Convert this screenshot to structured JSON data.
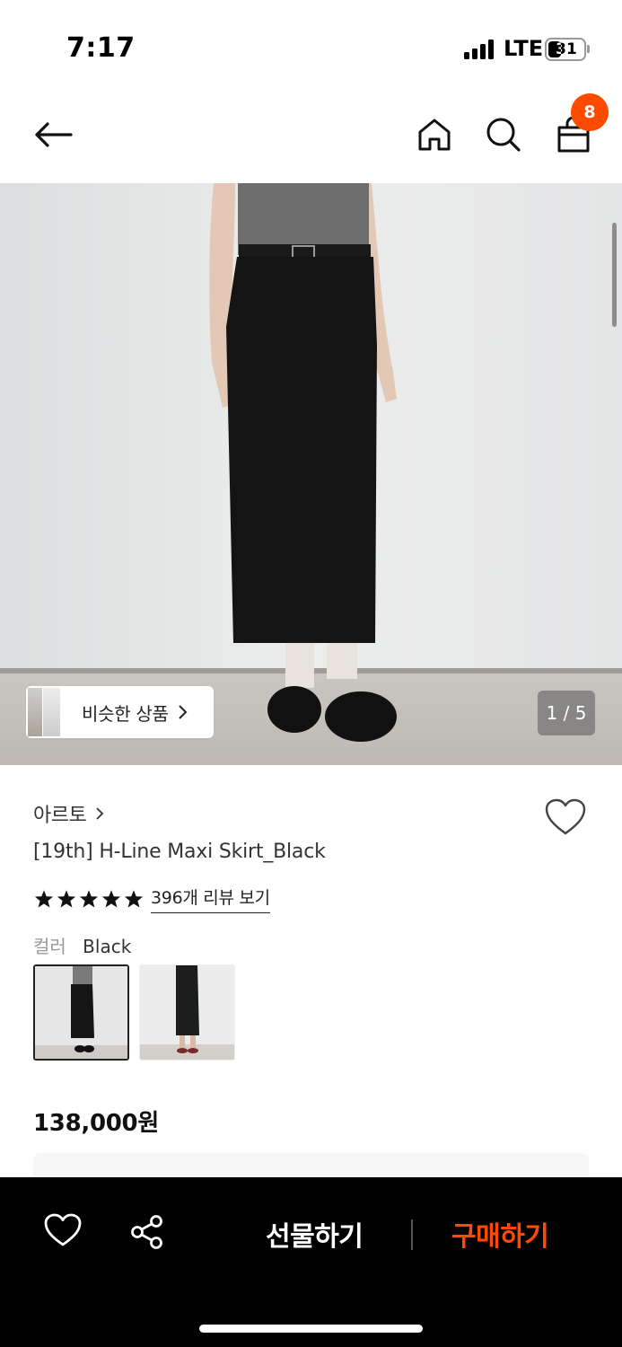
{
  "status_bar": {
    "time": "7:17",
    "network": "LTE",
    "battery": "31"
  },
  "nav": {
    "back_icon": "arrow-left-icon",
    "home_icon": "home-icon",
    "search_icon": "search-icon",
    "cart_icon": "shopping-bag-icon",
    "cart_count": "8"
  },
  "hero": {
    "similar_label": "비슷한 상품",
    "page_indicator": "1 / 5"
  },
  "product": {
    "brand": "아르토",
    "title": "[19th] H-Line Maxi Skirt_Black",
    "rating_stars": 5,
    "review_link": "396개 리뷰 보기",
    "color_key": "컬러",
    "color_value": "Black",
    "price": "138,000원"
  },
  "bottom_bar": {
    "gift_label": "선물하기",
    "buy_label": "구매하기"
  },
  "colors": {
    "accent": "#ff4b00",
    "bottom_bar_bg": "#000000"
  }
}
